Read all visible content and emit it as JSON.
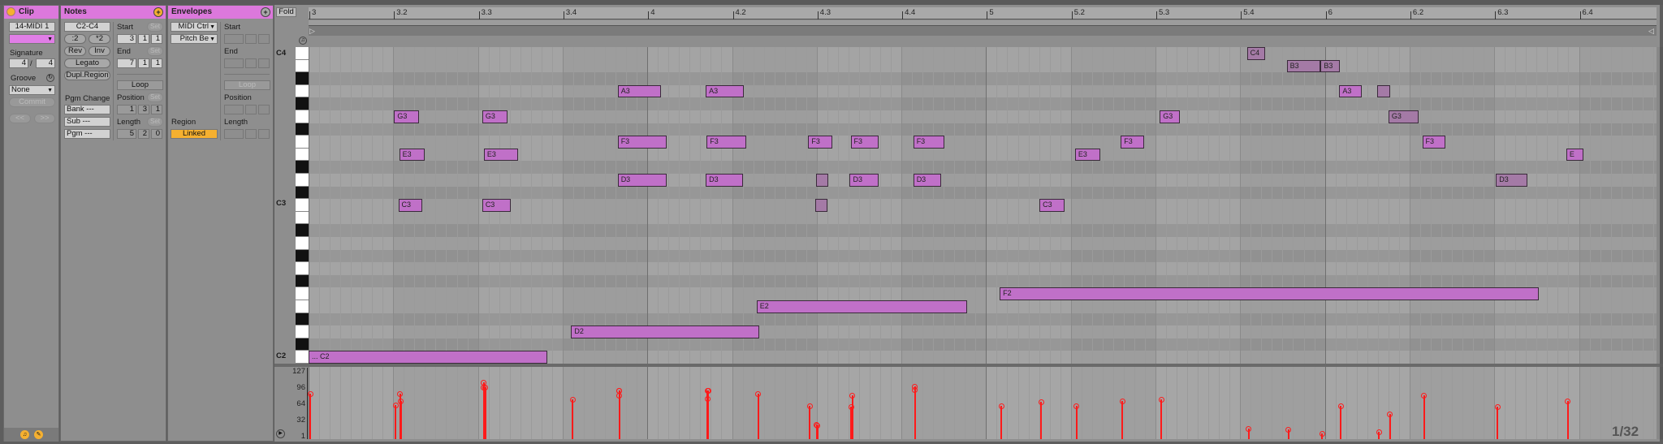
{
  "clip": {
    "title": "Clip",
    "name": "14-MIDI 1",
    "signature_label": "Signature",
    "sig_num": "4",
    "sig_sep": "/",
    "sig_den": "4",
    "groove_label": "Groove",
    "groove_value": "None",
    "commit": "Commit",
    "prev": "<<",
    "next": ">>",
    "color": "#e07ee6"
  },
  "notes": {
    "title": "Notes",
    "range": "C2-C4",
    "half": ":2",
    "double": "*2",
    "rev": "Rev",
    "inv": "Inv",
    "legato": "Legato",
    "dupl": "Dupl.Region",
    "pgm_change": "Pgm Change",
    "bank": "Bank ---",
    "sub": "Sub ---",
    "pgm": "Pgm ---",
    "start_label": "Start",
    "end_label": "End",
    "set": "Set",
    "start": [
      "3",
      "1",
      "1"
    ],
    "end": [
      "7",
      "1",
      "1"
    ],
    "loop": "Loop",
    "position_label": "Position",
    "position": [
      "1",
      "3",
      "1"
    ],
    "length_label": "Length",
    "length": [
      "5",
      "2",
      "0"
    ]
  },
  "envelopes": {
    "title": "Envelopes",
    "device": "MIDI Ctrl",
    "control": "Pitch Be",
    "region_label": "Region",
    "region": "Linked",
    "start_label": "Start",
    "end_label": "End",
    "loop": "Loop",
    "position_label": "Position",
    "length_label": "Length"
  },
  "editor": {
    "fold": "Fold",
    "ruler": [
      "3",
      "3.2",
      "3.3",
      "3.4",
      "4",
      "4.2",
      "4.3",
      "4.4",
      "5",
      "5.2",
      "5.3",
      "5.4",
      "6",
      "6.2",
      "6.3",
      "6.4"
    ],
    "key_labels": {
      "c4": "C4",
      "c3": "C3",
      "c2": "C2"
    },
    "vel_ticks": [
      "127",
      "96",
      "64",
      "32",
      "1"
    ],
    "grid": "1/32",
    "note_color": "#c070c8",
    "velocity_color": "#ff1a1a"
  },
  "piano_notes": [
    {
      "pitch": "C2",
      "start": 0,
      "len": 2.82,
      "vel": 85,
      "label": "... C2"
    },
    {
      "pitch": "D2",
      "start": 3.1,
      "len": 2.22,
      "vel": 73,
      "label": "D2"
    },
    {
      "pitch": "E2",
      "start": 5.29,
      "len": 2.49,
      "vel": 85,
      "label": "E2"
    },
    {
      "pitch": "F2",
      "start": 8.16,
      "len": 6.37,
      "vel": 61,
      "label": "F2"
    },
    {
      "pitch": "G3",
      "start": 1.01,
      "len": 0.29,
      "vel": 63,
      "label": "G3"
    },
    {
      "pitch": "C3",
      "start": 1.06,
      "len": 0.28,
      "vel": 85,
      "label": "C3"
    },
    {
      "pitch": "E3",
      "start": 1.07,
      "len": 0.3,
      "vel": 71,
      "label": "E3"
    },
    {
      "pitch": "G3",
      "start": 2.05,
      "len": 0.3,
      "vel": 97,
      "label": "G3"
    },
    {
      "pitch": "C3",
      "start": 2.05,
      "len": 0.34,
      "vel": 107,
      "label": "C3"
    },
    {
      "pitch": "E3",
      "start": 2.07,
      "len": 0.4,
      "vel": 97,
      "label": "E3"
    },
    {
      "pitch": "A3",
      "start": 3.65,
      "len": 0.51,
      "vel": 91,
      "label": "A3"
    },
    {
      "pitch": "F3",
      "start": 3.65,
      "len": 0.58,
      "vel": 81,
      "label": "F3"
    },
    {
      "pitch": "D3",
      "start": 3.65,
      "len": 0.58,
      "vel": 91,
      "label": "D3"
    },
    {
      "pitch": "A3",
      "start": 4.69,
      "len": 0.45,
      "vel": 75,
      "label": "A3"
    },
    {
      "pitch": "D3",
      "start": 4.69,
      "len": 0.44,
      "vel": 91,
      "label": "D3"
    },
    {
      "pitch": "F3",
      "start": 4.7,
      "len": 0.47,
      "vel": 91,
      "label": "F3"
    },
    {
      "pitch": "F3",
      "start": 5.9,
      "len": 0.28,
      "vel": 61,
      "label": "F3"
    },
    {
      "pitch": "C3",
      "start": 5.98,
      "len": 0.15,
      "vel": 25,
      "label": "",
      "dim": true
    },
    {
      "pitch": "D3",
      "start": 5.99,
      "len": 0.15,
      "vel": 23,
      "label": "",
      "dim": true
    },
    {
      "pitch": "F3",
      "start": 6.4,
      "len": 0.33,
      "vel": 81,
      "label": "F3"
    },
    {
      "pitch": "D3",
      "start": 6.39,
      "len": 0.34,
      "vel": 59,
      "label": "D3"
    },
    {
      "pitch": "F3",
      "start": 7.14,
      "len": 0.37,
      "vel": 99,
      "label": "F3"
    },
    {
      "pitch": "D3",
      "start": 7.14,
      "len": 0.33,
      "vel": 93,
      "label": "D3"
    },
    {
      "pitch": "C3",
      "start": 8.63,
      "len": 0.3,
      "vel": 69,
      "label": "C3"
    },
    {
      "pitch": "E3",
      "start": 9.05,
      "len": 0.3,
      "vel": 61,
      "label": "E3"
    },
    {
      "pitch": "F3",
      "start": 9.59,
      "len": 0.28,
      "vel": 71,
      "label": "F3"
    },
    {
      "pitch": "G3",
      "start": 10.05,
      "len": 0.24,
      "vel": 73,
      "label": "G3"
    },
    {
      "pitch": "C4",
      "start": 11.08,
      "len": 0.21,
      "vel": 17,
      "label": "C4",
      "dim": true
    },
    {
      "pitch": "B3",
      "start": 11.55,
      "len": 0.4,
      "vel": 15,
      "label": "B3",
      "dim": true
    },
    {
      "pitch": "B3",
      "start": 11.95,
      "len": 0.23,
      "vel": 7,
      "label": "B3",
      "dim": true
    },
    {
      "pitch": "A3",
      "start": 12.17,
      "len": 0.27,
      "vel": 61,
      "label": "A3"
    },
    {
      "pitch": "A3",
      "start": 12.62,
      "len": 0.15,
      "vel": 11,
      "label": "",
      "dim": true
    },
    {
      "pitch": "G3",
      "start": 12.75,
      "len": 0.36,
      "vel": 45,
      "label": "G3",
      "dim": true
    },
    {
      "pitch": "F3",
      "start": 13.15,
      "len": 0.27,
      "vel": 81,
      "label": "F3"
    },
    {
      "pitch": "D3",
      "start": 14.02,
      "len": 0.37,
      "vel": 59,
      "label": "D3",
      "dim": true
    },
    {
      "pitch": "E",
      "start": 14.85,
      "len": 0.2,
      "vel": 71,
      "label": "E",
      "row": "E3"
    }
  ]
}
